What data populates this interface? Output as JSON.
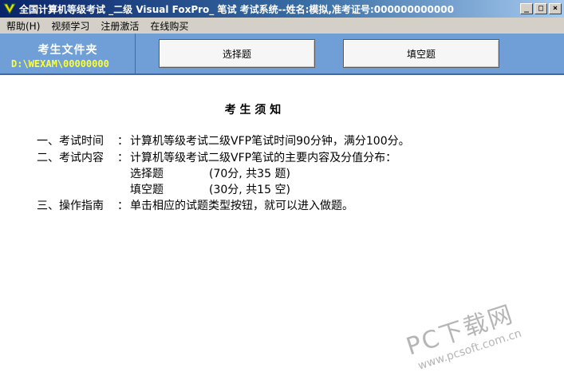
{
  "window": {
    "title": "全国计算机等级考试 _二级 Visual FoxPro_ 笔试 考试系统--姓名:模拟,准考证号:000000000000",
    "icon": "v-check-icon",
    "controls": {
      "minimize": "_",
      "maximize": "□",
      "close": "×"
    }
  },
  "menu": {
    "items": [
      {
        "label": "帮助(H)"
      },
      {
        "label": "视频学习"
      },
      {
        "label": "注册激活"
      },
      {
        "label": "在线购买"
      }
    ]
  },
  "toolbar": {
    "folder_title": "考生文件夹",
    "folder_path": "D:\\WEXAM\\00000000",
    "buttons": [
      {
        "label": "选择题"
      },
      {
        "label": "填空题"
      }
    ],
    "colors": {
      "background": "#6f9fd6",
      "path_text": "#ffff33"
    }
  },
  "notice": {
    "title": "考 生 须 知",
    "lines": [
      {
        "num": "一、考试时间",
        "sep": "：",
        "text": "计算机等级考试二级VFP笔试时间90分钟，满分100分。"
      },
      {
        "num": "二、考试内容",
        "sep": "：",
        "text": "计算机等级考试二级VFP笔试的主要内容及分值分布："
      },
      {
        "num": "",
        "sep": "",
        "text": "选择题",
        "detail": "(70分, 共35 题)"
      },
      {
        "num": "",
        "sep": "",
        "text": "填空题",
        "detail": "(30分, 共15 空)"
      },
      {
        "num": "三、操作指南",
        "sep": "：",
        "text": "单击相应的试题类型按钮，就可以进入做题。"
      }
    ]
  },
  "watermark": {
    "main": "PC下载网",
    "sub": "www.pcsoft.com.cn"
  }
}
